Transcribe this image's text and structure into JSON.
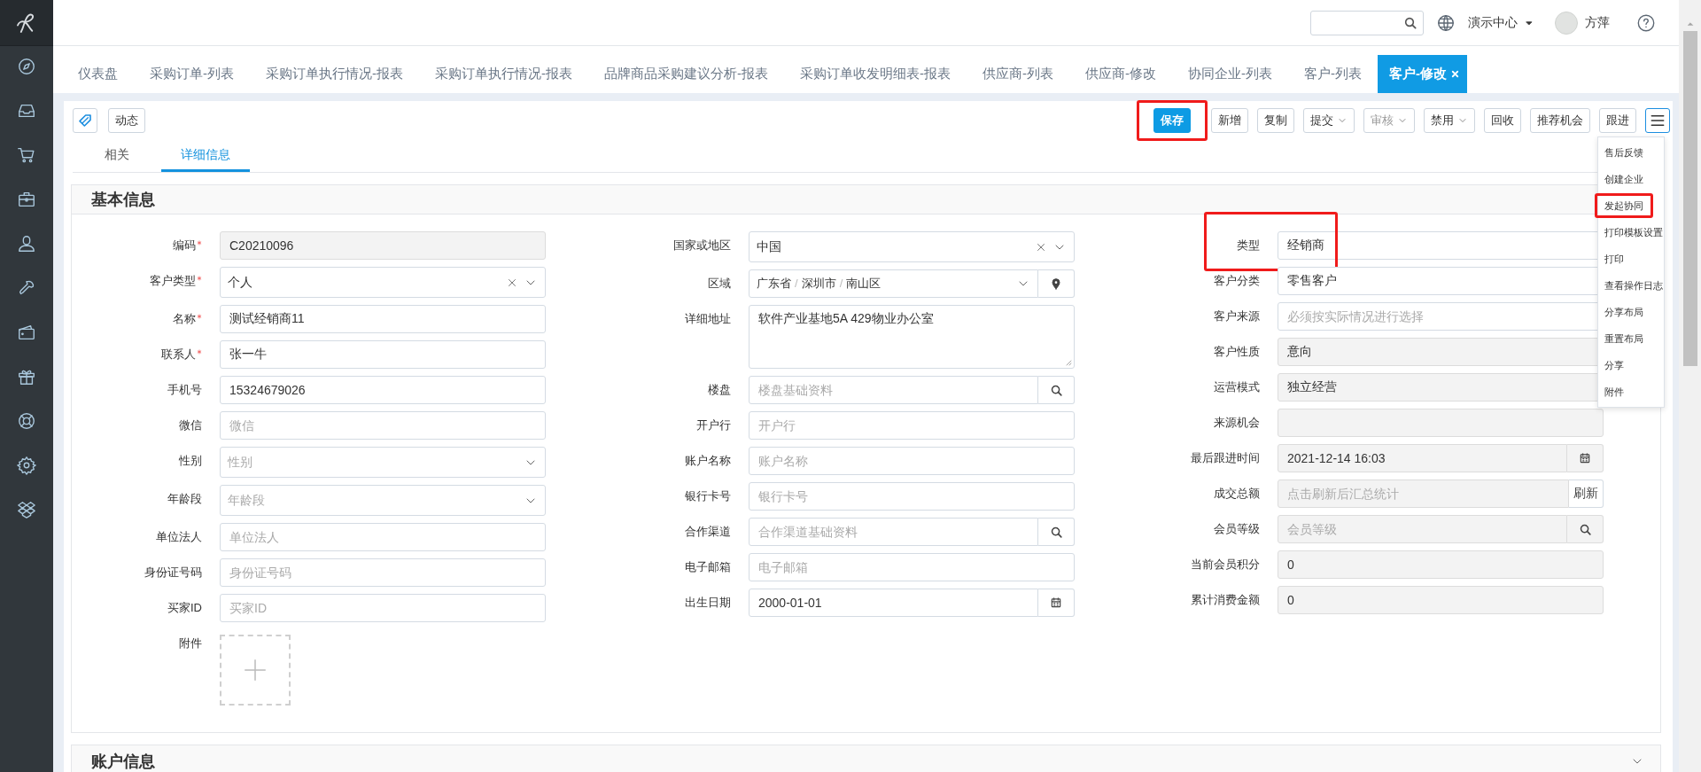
{
  "header": {
    "org_menu": "演示中心",
    "user": "方萍"
  },
  "tabs": [
    {
      "label": "仪表盘",
      "selected": false,
      "closable": false
    },
    {
      "label": "采购订单-列表",
      "selected": false,
      "closable": false
    },
    {
      "label": "采购订单执行情况-报表",
      "selected": false,
      "closable": false
    },
    {
      "label": "采购订单执行情况-报表",
      "selected": false,
      "closable": false
    },
    {
      "label": "品牌商品采购建议分析-报表",
      "selected": false,
      "closable": false
    },
    {
      "label": "采购订单收发明细表-报表",
      "selected": false,
      "closable": false
    },
    {
      "label": "供应商-列表",
      "selected": false,
      "closable": false
    },
    {
      "label": "供应商-修改",
      "selected": false,
      "closable": false
    },
    {
      "label": "协同企业-列表",
      "selected": false,
      "closable": false
    },
    {
      "label": "客户-列表",
      "selected": false,
      "closable": false
    },
    {
      "label": "客户-修改",
      "selected": true,
      "closable": true
    }
  ],
  "toolbar": {
    "activity_button": "动态",
    "actions": [
      {
        "label": "保存",
        "kind": "primary",
        "disabled": false,
        "highlighted": true
      },
      {
        "label": "新增",
        "kind": "plain",
        "disabled": false,
        "highlighted": false
      },
      {
        "label": "复制",
        "kind": "plain",
        "disabled": false,
        "highlighted": false
      },
      {
        "label": "提交",
        "kind": "dropdown",
        "disabled": false,
        "highlighted": false
      },
      {
        "label": "审核",
        "kind": "dropdown",
        "disabled": true,
        "highlighted": false
      },
      {
        "label": "禁用",
        "kind": "dropdown",
        "disabled": false,
        "highlighted": false
      },
      {
        "label": "回收",
        "kind": "plain",
        "disabled": false,
        "highlighted": false
      },
      {
        "label": "推荐机会",
        "kind": "plain",
        "disabled": false,
        "highlighted": false
      },
      {
        "label": "跟进",
        "kind": "plain",
        "disabled": false,
        "highlighted": false
      }
    ]
  },
  "more_menu": {
    "items": [
      {
        "label": "售后反馈",
        "highlighted": false
      },
      {
        "label": "创建企业",
        "highlighted": false
      },
      {
        "label": "发起协同",
        "highlighted": true
      },
      {
        "label": "打印模板设置",
        "highlighted": false
      },
      {
        "label": "打印",
        "highlighted": false
      },
      {
        "label": "查看操作日志",
        "highlighted": false
      },
      {
        "label": "分享布局",
        "highlighted": false
      },
      {
        "label": "重置布局",
        "highlighted": false
      },
      {
        "label": "分享",
        "highlighted": false
      },
      {
        "label": "附件",
        "highlighted": false
      }
    ]
  },
  "view_tabs": [
    {
      "label": "相关",
      "selected": false
    },
    {
      "label": "详细信息",
      "selected": true
    }
  ],
  "sections": [
    {
      "title": "基本信息",
      "expanded": true,
      "columns": [
        [
          {
            "label": "编码",
            "kind": "text",
            "value": "C20210096",
            "required": true,
            "disabled": true,
            "highlighted": false
          },
          {
            "label": "客户类型",
            "kind": "select",
            "value": "个人",
            "required": true,
            "disabled": false,
            "highlighted": false
          },
          {
            "label": "名称",
            "kind": "text",
            "value": "测试经销商11",
            "required": true,
            "disabled": false,
            "highlighted": false
          },
          {
            "label": "联系人",
            "kind": "text",
            "value": "张一牛",
            "required": true,
            "disabled": false,
            "highlighted": false
          },
          {
            "label": "手机号",
            "kind": "text",
            "value": "15324679026",
            "required": false,
            "disabled": false,
            "highlighted": false
          },
          {
            "label": "微信",
            "kind": "text",
            "placeholder": "微信",
            "required": false,
            "disabled": false,
            "highlighted": false
          },
          {
            "label": "性别",
            "kind": "select",
            "placeholder": "性别",
            "required": false,
            "disabled": false,
            "highlighted": false
          },
          {
            "label": "年龄段",
            "kind": "select",
            "placeholder": "年龄段",
            "required": false,
            "disabled": false,
            "highlighted": false
          },
          {
            "label": "单位法人",
            "kind": "text",
            "placeholder": "单位法人",
            "required": false,
            "disabled": false,
            "highlighted": false
          },
          {
            "label": "身份证号码",
            "kind": "text",
            "placeholder": "身份证号码",
            "required": false,
            "disabled": false,
            "highlighted": false
          },
          {
            "label": "买家ID",
            "kind": "text",
            "placeholder": "买家ID",
            "required": false,
            "disabled": false,
            "highlighted": false
          },
          {
            "label": "附件",
            "kind": "upload",
            "required": false,
            "disabled": false,
            "highlighted": false
          }
        ],
        [
          {
            "label": "国家或地区",
            "kind": "select",
            "value": "中国",
            "required": false,
            "disabled": false,
            "highlighted": false
          },
          {
            "label": "区域",
            "kind": "region",
            "path": [
              "广东省",
              "深圳市",
              "南山区"
            ],
            "separator": "/",
            "required": false,
            "disabled": false,
            "highlighted": false
          },
          {
            "label": "详细地址",
            "kind": "textarea",
            "value": "软件产业基地5A 429物业办公室",
            "required": false,
            "disabled": false,
            "highlighted": false
          },
          {
            "label": "楼盘",
            "kind": "search",
            "placeholder": "楼盘基础资料",
            "required": false,
            "disabled": false,
            "highlighted": false
          },
          {
            "label": "开户行",
            "kind": "text",
            "placeholder": "开户行",
            "required": false,
            "disabled": false,
            "highlighted": false
          },
          {
            "label": "账户名称",
            "kind": "text",
            "placeholder": "账户名称",
            "required": false,
            "disabled": false,
            "highlighted": false
          },
          {
            "label": "银行卡号",
            "kind": "text",
            "placeholder": "银行卡号",
            "required": false,
            "disabled": false,
            "highlighted": false
          },
          {
            "label": "合作渠道",
            "kind": "search",
            "placeholder": "合作渠道基础资料",
            "required": false,
            "disabled": false,
            "highlighted": false
          },
          {
            "label": "电子邮箱",
            "kind": "text",
            "placeholder": "电子邮箱",
            "required": false,
            "disabled": false,
            "highlighted": false
          },
          {
            "label": "出生日期",
            "kind": "date",
            "value": "2000-01-01",
            "required": false,
            "disabled": false,
            "highlighted": false
          }
        ],
        [
          {
            "label": "类型",
            "kind": "text",
            "value": "经销商",
            "required": false,
            "disabled": false,
            "highlighted": true
          },
          {
            "label": "客户分类",
            "kind": "text",
            "value": "零售客户",
            "required": false,
            "disabled": false,
            "highlighted": false
          },
          {
            "label": "客户来源",
            "kind": "text",
            "placeholder": "必须按实际情况进行选择",
            "required": false,
            "disabled": false,
            "highlighted": false
          },
          {
            "label": "客户性质",
            "kind": "text",
            "value": "意向",
            "required": false,
            "disabled": true,
            "highlighted": false
          },
          {
            "label": "运营模式",
            "kind": "text",
            "value": "独立经营",
            "required": false,
            "disabled": true,
            "highlighted": false
          },
          {
            "label": "来源机会",
            "kind": "text",
            "required": false,
            "disabled": true,
            "highlighted": false
          },
          {
            "label": "最后跟进时间",
            "kind": "date",
            "value": "2021-12-14 16:03",
            "required": false,
            "disabled": true,
            "highlighted": false
          },
          {
            "label": "成交总额",
            "kind": "action",
            "placeholder": "点击刷新后汇总统计",
            "addon_label": "刷新",
            "required": false,
            "disabled": true,
            "highlighted": false
          },
          {
            "label": "会员等级",
            "kind": "search",
            "placeholder": "会员等级",
            "required": false,
            "disabled": true,
            "highlighted": false
          },
          {
            "label": "当前会员积分",
            "kind": "text",
            "value": "0",
            "required": false,
            "disabled": true,
            "highlighted": false
          },
          {
            "label": "累计消费金额",
            "kind": "text",
            "value": "0",
            "required": false,
            "disabled": true,
            "highlighted": false
          }
        ]
      ]
    },
    {
      "title": "账户信息",
      "expanded": false
    }
  ]
}
